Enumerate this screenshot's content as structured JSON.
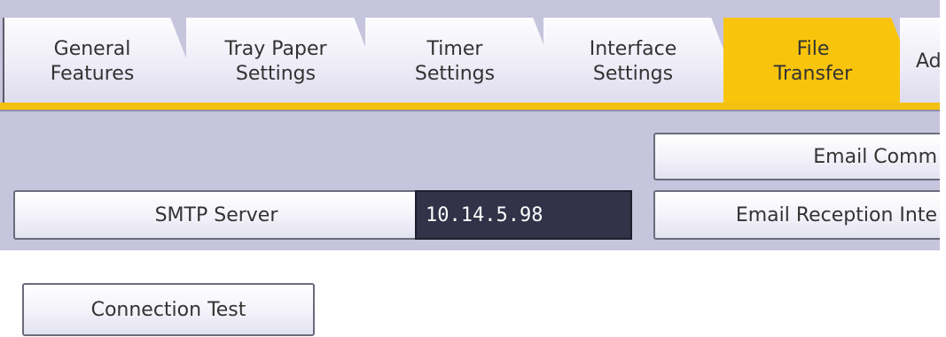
{
  "tabs": [
    {
      "line1": "General",
      "line2": "Features",
      "active": false
    },
    {
      "line1": "Tray Paper",
      "line2": "Settings",
      "active": false
    },
    {
      "line1": "Timer",
      "line2": "Settings",
      "active": false
    },
    {
      "line1": "Interface",
      "line2": "Settings",
      "active": false
    },
    {
      "line1": "File",
      "line2": "Transfer",
      "active": true
    },
    {
      "line1": "Adr",
      "line2": "",
      "active": false
    }
  ],
  "email_comm_label": "Email Comm",
  "smtp_server_label": "SMTP Server",
  "smtp_server_value": "10.14.5.98",
  "email_reception_label": "Email Reception Inte",
  "connection_test_label": "Connection Test",
  "colors": {
    "active_tab": "#f9c50c",
    "panel_bg": "#c6c5dd",
    "value_box_bg": "#323248"
  }
}
